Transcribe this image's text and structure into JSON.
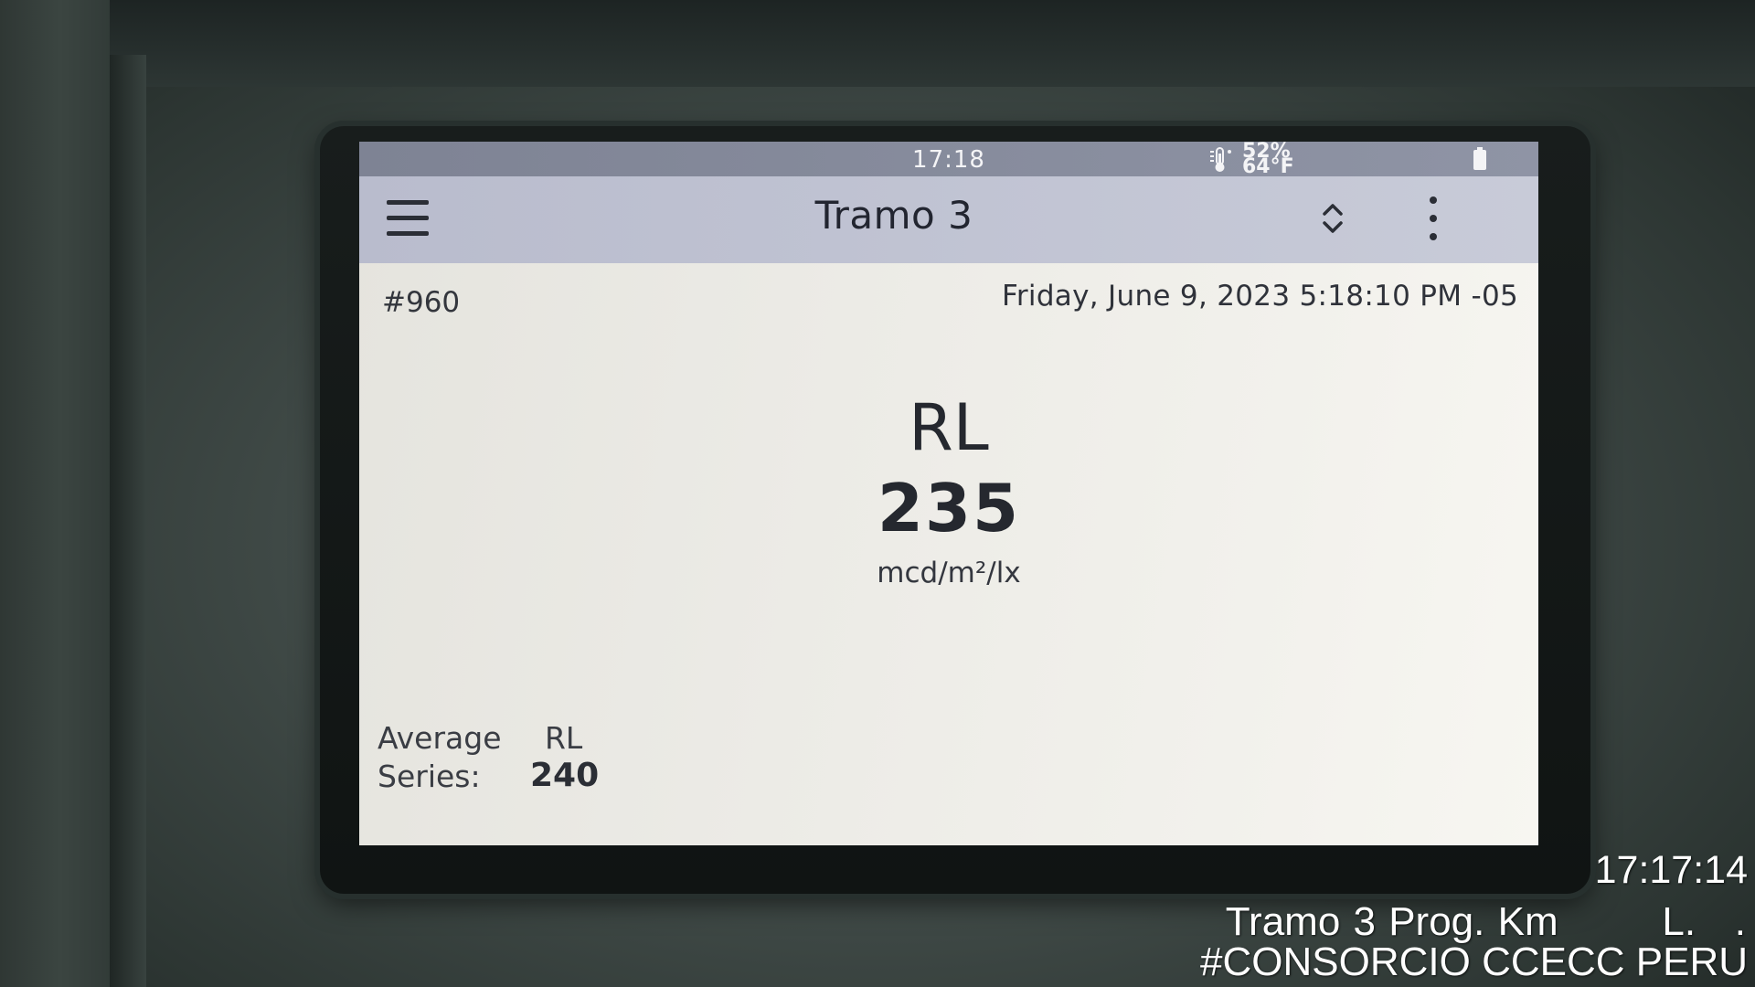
{
  "device": {
    "status_bar": {
      "time": "17:18",
      "humidity": "52%",
      "temperature": "64°F",
      "icons": [
        "thermometer-icon",
        "battery-icon"
      ]
    },
    "app_bar": {
      "title": "Tramo 3",
      "icons": [
        "menu-icon",
        "sort-icon",
        "more-vert-icon"
      ]
    },
    "record": {
      "id": "#960",
      "datetime": "Friday, June 9, 2023 5:18:10 PM -05",
      "parameter": "RL",
      "value": "235",
      "unit": "mcd/m²/lx"
    },
    "average": {
      "label_line1": "Average",
      "label_line2": "Series:",
      "parameter": "RL",
      "value": "240"
    }
  },
  "photo_stamp": {
    "time": "17:17:14",
    "location": "Tramo 3 Prog. Km        L.   .",
    "company": "#CONSORCIO CCECC PERU"
  },
  "colors": {
    "status_bar": "#868b9c",
    "app_bar": "#c2c5d4",
    "screen_bg": "#eeede8",
    "text_dark": "#25282f",
    "bezel": "#141918",
    "stamp_text": "#ffffff"
  }
}
